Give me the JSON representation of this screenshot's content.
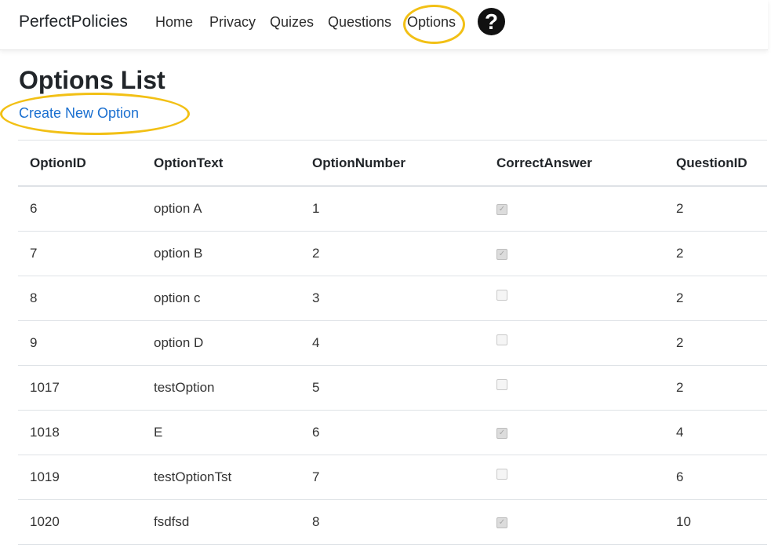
{
  "navbar": {
    "brand": "PerfectPolicies",
    "links": [
      "Home",
      "Privacy",
      "Quizes",
      "Questions",
      "Options"
    ],
    "help_symbol": "?"
  },
  "page": {
    "title": "Options List",
    "create_link": "Create New Option"
  },
  "table": {
    "headers": [
      "OptionID",
      "OptionText",
      "OptionNumber",
      "CorrectAnswer",
      "QuestionID"
    ],
    "rows": [
      {
        "id": "6",
        "text": "option A",
        "number": "1",
        "correct": true,
        "question_id": "2"
      },
      {
        "id": "7",
        "text": "option B",
        "number": "2",
        "correct": true,
        "question_id": "2"
      },
      {
        "id": "8",
        "text": "option c",
        "number": "3",
        "correct": false,
        "question_id": "2"
      },
      {
        "id": "9",
        "text": "option D",
        "number": "4",
        "correct": false,
        "question_id": "2"
      },
      {
        "id": "1017",
        "text": "testOption",
        "number": "5",
        "correct": false,
        "question_id": "2"
      },
      {
        "id": "1018",
        "text": "E",
        "number": "6",
        "correct": true,
        "question_id": "4"
      },
      {
        "id": "1019",
        "text": "testOptionTst",
        "number": "7",
        "correct": false,
        "question_id": "6"
      },
      {
        "id": "1020",
        "text": "fsdfsd",
        "number": "8",
        "correct": true,
        "question_id": "10"
      }
    ]
  },
  "colors": {
    "highlight": "#f2c015",
    "link": "#1a6fd0"
  }
}
